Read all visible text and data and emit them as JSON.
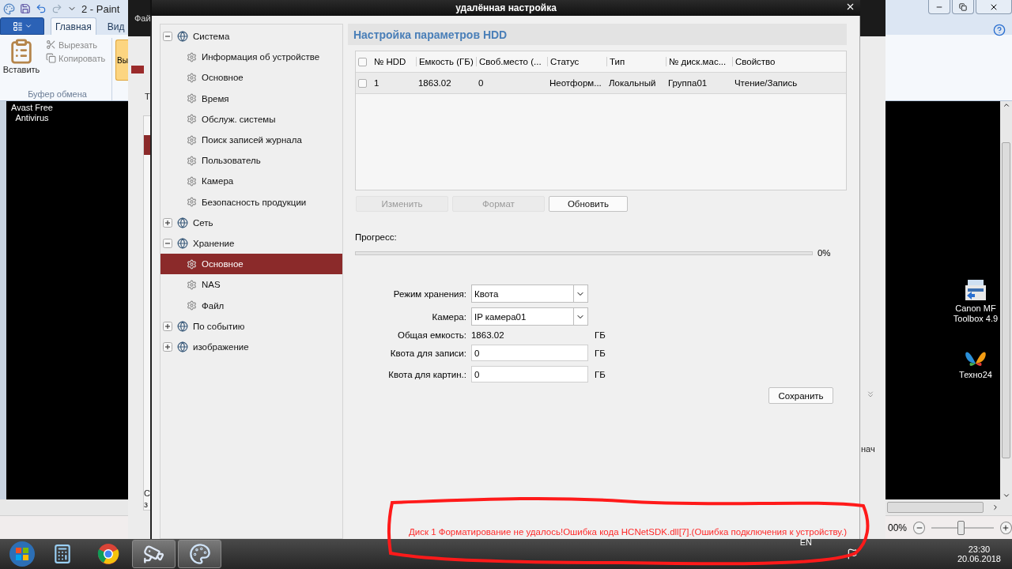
{
  "paint": {
    "title": "2 - Paint",
    "ribbon_tabs": [
      {
        "label": "Главная",
        "selected": true
      },
      {
        "label": "Вид",
        "selected": false
      }
    ],
    "clipboard": {
      "paste": "Вставить",
      "cut": "Вырезать",
      "copy": "Копировать",
      "group": "Буфер обмена"
    },
    "next_group_button": "Вы",
    "canvas_items": [
      {
        "kind": "text",
        "label": "Avast Free\nAntivirus"
      },
      {
        "kind": "printer",
        "label": "Canon MF\nToolbox 4.9"
      },
      {
        "kind": "butterfly",
        "label": "Техно24"
      }
    ],
    "zoom": "00%",
    "zoom_slider": {
      "level": 0.47
    }
  },
  "client_window": {
    "menu": "Фай",
    "tab": "Т",
    "left_texts": [
      "С",
      "з"
    ],
    "right_text": "нач"
  },
  "dialog": {
    "title": "удалённая настройка",
    "tree": [
      {
        "label": "Система",
        "expanded": true,
        "selected": false,
        "children": [
          {
            "label": "Информация об устройстве",
            "selected": false
          },
          {
            "label": "Основное",
            "selected": false
          },
          {
            "label": "Время",
            "selected": false
          },
          {
            "label": "Обслуж. системы",
            "selected": false
          },
          {
            "label": "Поиск записей журнала",
            "selected": false
          },
          {
            "label": "Пользователь",
            "selected": false
          },
          {
            "label": "Камера",
            "selected": false
          },
          {
            "label": "Безопасность продукции",
            "selected": false
          }
        ]
      },
      {
        "label": "Сеть",
        "expanded": false,
        "selected": false
      },
      {
        "label": "Хранение",
        "expanded": true,
        "selected": false,
        "children": [
          {
            "label": "Основное",
            "selected": true
          },
          {
            "label": "NAS",
            "selected": false
          },
          {
            "label": "Файл",
            "selected": false
          }
        ]
      },
      {
        "label": "По событию",
        "expanded": false,
        "selected": false
      },
      {
        "label": "изображение",
        "expanded": false,
        "selected": false
      }
    ],
    "heading": "Настройка параметров HDD",
    "table": {
      "all_checked": false,
      "columns": [
        "№ HDD",
        "Емкость (ГБ)",
        "Своб.место (...",
        "Статус",
        "Тип",
        "№ диск.мас...",
        "Свойство"
      ],
      "rows": [
        {
          "checked": false,
          "cells": [
            "1",
            "1863.02",
            "0",
            "Неотформ...",
            "Локальный",
            "Группа01",
            "Чтение/Запись"
          ]
        }
      ]
    },
    "buttons": [
      {
        "label": "Изменить",
        "disabled": true
      },
      {
        "label": "Формат",
        "disabled": true
      },
      {
        "label": "Обновить",
        "disabled": false
      }
    ],
    "progress": {
      "label": "Прогресс:",
      "level": 0,
      "reading": "0%"
    },
    "form": [
      {
        "kind": "select",
        "label": "Режим хранения:",
        "value": "Квота"
      },
      {
        "kind": "select",
        "label": "Камера:",
        "value": "IP камера01"
      },
      {
        "kind": "text",
        "label": "Общая емкость:",
        "value": "1863.02",
        "unit": "ГБ"
      },
      {
        "kind": "input",
        "label": "Квота для записи:",
        "value": "0",
        "unit": "ГБ"
      },
      {
        "kind": "input",
        "label": "Квота для картин.:",
        "value": "0",
        "unit": "ГБ"
      }
    ],
    "save": "Сохранить",
    "error": "Диск 1  Форматирование не удалось!Ошибка кода HCNetSDK.dll[7].(Ошибка подключения к устройству.)"
  },
  "taskbar": {
    "apps": [
      {
        "kind": "calculator",
        "active": false
      },
      {
        "kind": "browser",
        "active": false
      },
      {
        "kind": "camera",
        "active": true
      },
      {
        "kind": "paint",
        "active": true
      }
    ],
    "language": "EN",
    "time": "23:30",
    "date": "20.06.2018"
  }
}
